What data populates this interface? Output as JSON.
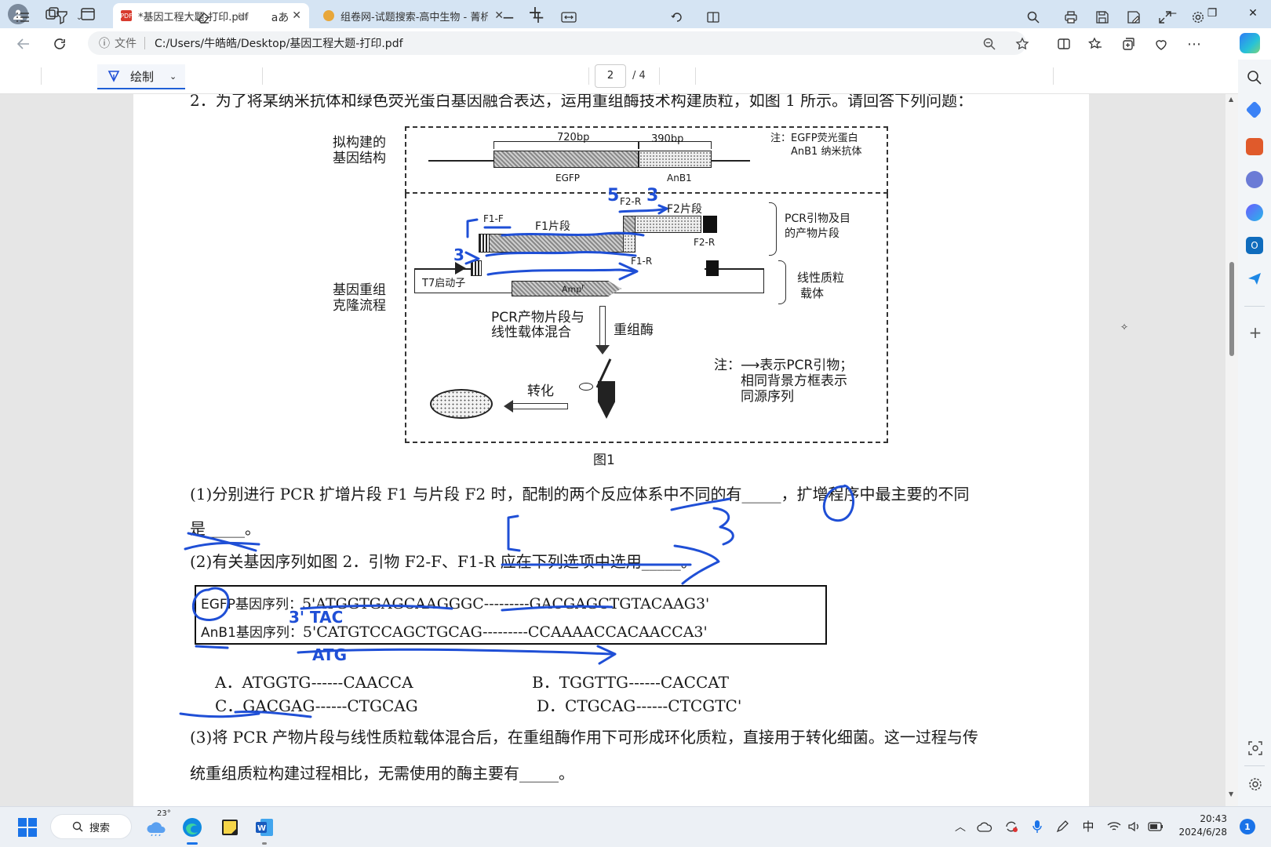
{
  "browser": {
    "tabs": [
      {
        "title": "*基因工程大题-打印.pdf",
        "active": true,
        "icon": "pdf-icon"
      },
      {
        "title": "组卷网-试题搜索-高中生物 - 菁析",
        "active": false,
        "icon": "zujuan-icon"
      }
    ],
    "new_tab_label": "+",
    "window": {
      "minimize": "—",
      "maximize": "❐",
      "close": "✕"
    },
    "address": {
      "info_label": "文件",
      "url": "C:/Users/牛皓皓/Desktop/基因工程大题-打印.pdf"
    }
  },
  "pdf_toolbar": {
    "draw_label": "绘制",
    "read_aloud_glyph": "aあ",
    "page_current": "2",
    "page_total": "/ 4"
  },
  "document": {
    "q2_intro": "2．为了将某纳米抗体和绿色荧光蛋白基因融合表达，运用重组酶技术构建质粒，如图 1 所示。请回答下列问题：",
    "figure": {
      "label_construct": [
        "拟构建的",
        "基因结构"
      ],
      "egfp_bp": "720bp",
      "anb1_bp": "390bp",
      "egfp_name": "EGFP",
      "anb1_name": "AnB1",
      "note_top": [
        "注：EGFP荧光蛋白",
        "AnB1 纳米抗体"
      ],
      "label_flow": [
        "基因重组",
        "克隆流程"
      ],
      "f1f": "F1-F",
      "f1_fragment": "F1片段",
      "f2r_top": "F2-R",
      "f2_fragment": "F2片段",
      "f2r": "F2-R",
      "f1r": "F1-R",
      "pcr_label": [
        "PCR引物及目",
        "的产物片段"
      ],
      "plasmid_label": [
        "线性质粒",
        "载体"
      ],
      "t7": "T7启动子",
      "amp": "Amp",
      "mix_label": [
        "PCR产物片段与",
        "线性载体混合"
      ],
      "recombinase": "重组酶",
      "transform": "转化",
      "note_bottom": [
        "注：⟶表示PCR引物；",
        "相同背景方框表示",
        "同源序列"
      ],
      "caption": "图1"
    },
    "q1_line1": "(1)分别进行 PCR 扩增片段 F1 与片段 F2 时，配制的两个反应体系中不同的有_____，扩增程序中最主要的不同",
    "q1_line2": "是_____。",
    "q2_line": "(2)有关基因序列如图 2．引物 F2-F、F1-R 应在下列选项中选用_____。",
    "seq_egfp_label": "EGFP基因序列：",
    "seq_egfp": "5'ATGGTGAGCAAGGGC---------GACGAGCTGTACAAG3'",
    "seq_anb1_label": "AnB1基因序列：",
    "seq_anb1": "5'CATGTCCAGCTGCAG---------CCAAAACCACAACCA3'",
    "options": {
      "A": "A．ATGGTG------CAACCA",
      "B": "B．TGGTTG------CACCAT",
      "C": "C．GACGAG------CTGCAG",
      "D": "D．CTGCAG------CTCGTC'"
    },
    "q3_line1": "(3)将 PCR 产物片段与线性质粒载体混合后，在重组酶作用下可形成环化质粒，直接用于转化细菌。这一过程与传",
    "q3_line2": "统重组质粒构建过程相比，无需使用的酶主要有_____。",
    "handwriting": {
      "tac": "3' TAC",
      "atg": "ATG",
      "five": "5",
      "three": "3"
    }
  },
  "taskbar": {
    "search_label": "搜索",
    "weather_temp": "23°",
    "ime": "中",
    "time": "20:43",
    "date": "2024/6/28",
    "notification_count": "1"
  },
  "colors": {
    "ink_blue": "#1f4fd6",
    "tab_bar": "#d5e4f3",
    "page_bg": "#ffffff"
  }
}
